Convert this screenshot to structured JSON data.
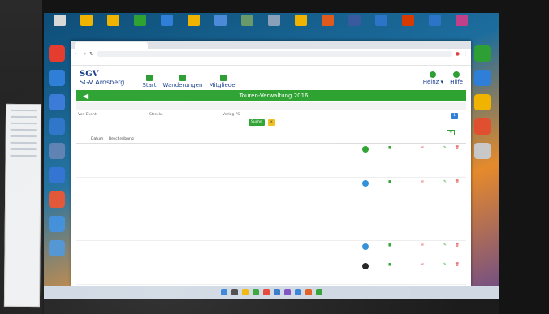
{
  "desktop": {
    "top_icons": [
      {
        "label": "",
        "color": "#d8d8d8"
      },
      {
        "label": "",
        "color": "#f0b400"
      },
      {
        "label": "",
        "color": "#f0b400"
      },
      {
        "label": "",
        "color": "#2ea332"
      },
      {
        "label": "",
        "color": "#2f7fd8"
      },
      {
        "label": "",
        "color": "#f0b400"
      },
      {
        "label": "",
        "color": "#4a8ad8"
      },
      {
        "label": "",
        "color": "#6a9a6a"
      },
      {
        "label": "",
        "color": "#8aa0b8"
      },
      {
        "label": "",
        "color": "#f0b400"
      },
      {
        "label": "",
        "color": "#e05a1c"
      },
      {
        "label": "",
        "color": "#3a5aa0"
      },
      {
        "label": "",
        "color": "#2c74c8"
      },
      {
        "label": "",
        "color": "#d83b01"
      },
      {
        "label": "",
        "color": "#2c74c8"
      },
      {
        "label": "",
        "color": "#c0408a"
      }
    ],
    "side_icons": [
      "#e43d2f",
      "#2f7fd8",
      "#3a7ad8",
      "#2c74c8",
      "#5a7fb0",
      "#2c6fd0",
      "#e05030",
      "#3a8ad8",
      "#4a90d0"
    ],
    "right_icons": [
      "#2e9f34",
      "#2f7fd8",
      "#f0b400",
      "#e05030",
      "#c8c8c8"
    ],
    "taskbar_icons": [
      "#2f7fd8",
      "#444",
      "#f0b400",
      "#2ea332",
      "#e43d2f",
      "#2c74c8",
      "#7a4ac0",
      "#2f7fd8",
      "#e05a1c",
      "#2e9f34"
    ],
    "clock": ""
  },
  "browser": {
    "tab_title": "",
    "url": "",
    "bookmarks": [
      "",
      "",
      "",
      "",
      "",
      "",
      ""
    ]
  },
  "app": {
    "logo_mark": "SGV",
    "logo_name": "SGV Arnsberg",
    "menu": [
      {
        "label": "Start"
      },
      {
        "label": "Wanderungen"
      },
      {
        "label": "Mitglieder"
      }
    ],
    "user_label": "Heinz ▾",
    "help_label": "Hilfe",
    "bar_title": "Touren-Verwaltung 2016",
    "months": [
      "",
      "",
      "",
      "",
      "",
      "",
      "",
      "",
      "",
      ""
    ],
    "filters": {
      "label1": "Von Event",
      "label2": "Strecke",
      "label3": "Verlag PS",
      "btn_ok": "Suche",
      "btn_reset": "x"
    },
    "columns": {
      "date": "Datum",
      "desc": "Beschreibung",
      "status": "",
      "places": "",
      "notes": ""
    },
    "rows": [
      {
        "date": "",
        "title": "",
        "body": ""
      },
      {
        "date": "",
        "title": "",
        "body": ""
      },
      {
        "date": "",
        "title": "",
        "body": ""
      },
      {
        "date": "",
        "title": "",
        "body": ""
      }
    ],
    "status_colors": {
      "green": "#2ea332",
      "blue": "#2f8fd8",
      "dark": "#222",
      "red": "#e04040"
    }
  }
}
